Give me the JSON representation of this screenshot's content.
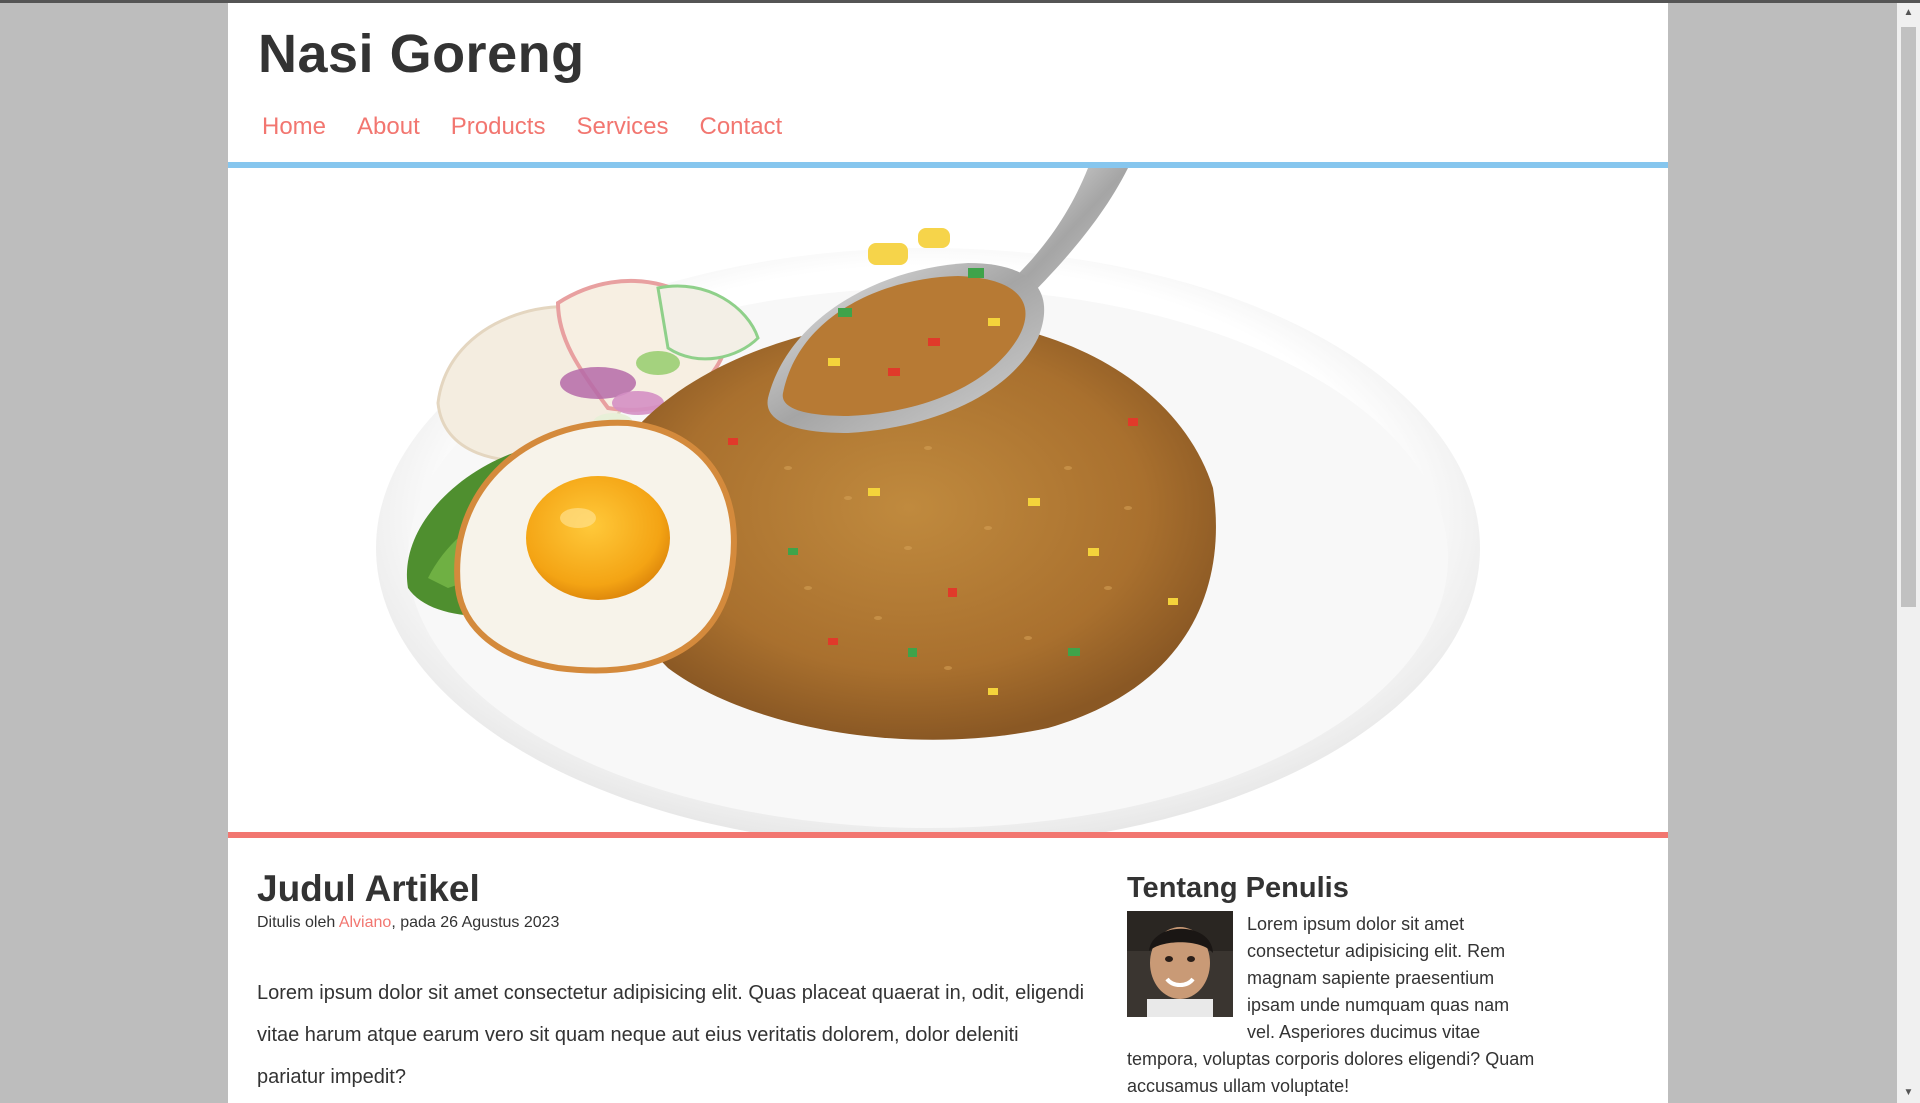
{
  "site": {
    "title": "Nasi Goreng"
  },
  "nav": {
    "home": "Home",
    "about": "About",
    "products": "Products",
    "services": "Services",
    "contact": "Contact"
  },
  "article": {
    "title": "Judul Artikel",
    "meta_prefix": "Ditulis oleh ",
    "author": "Alviano",
    "meta_suffix": ", pada 26 Agustus 2023",
    "body": "Lorem ipsum dolor sit amet consectetur adipisicing elit. Quas placeat quaerat in, odit, eligendi vitae harum atque earum vero sit quam neque aut eius veritatis dolorem, dolor deleniti pariatur impedit?"
  },
  "aside": {
    "title": "Tentang Penulis",
    "text": "Lorem ipsum dolor sit amet consectetur adipisicing elit. Rem magnam sapiente praesentium ipsam unde numquam quas nam vel. Asperiores ducimus vitae tempora, voluptas corporis dolores eligendi? Quam accusamus ullam voluptate!"
  },
  "colors": {
    "accent": "#f27670",
    "blue_bar": "#86c6ee",
    "text": "#333333"
  },
  "icons": {
    "scroll_up": "chevron-up-icon",
    "scroll_down": "chevron-down-icon"
  }
}
